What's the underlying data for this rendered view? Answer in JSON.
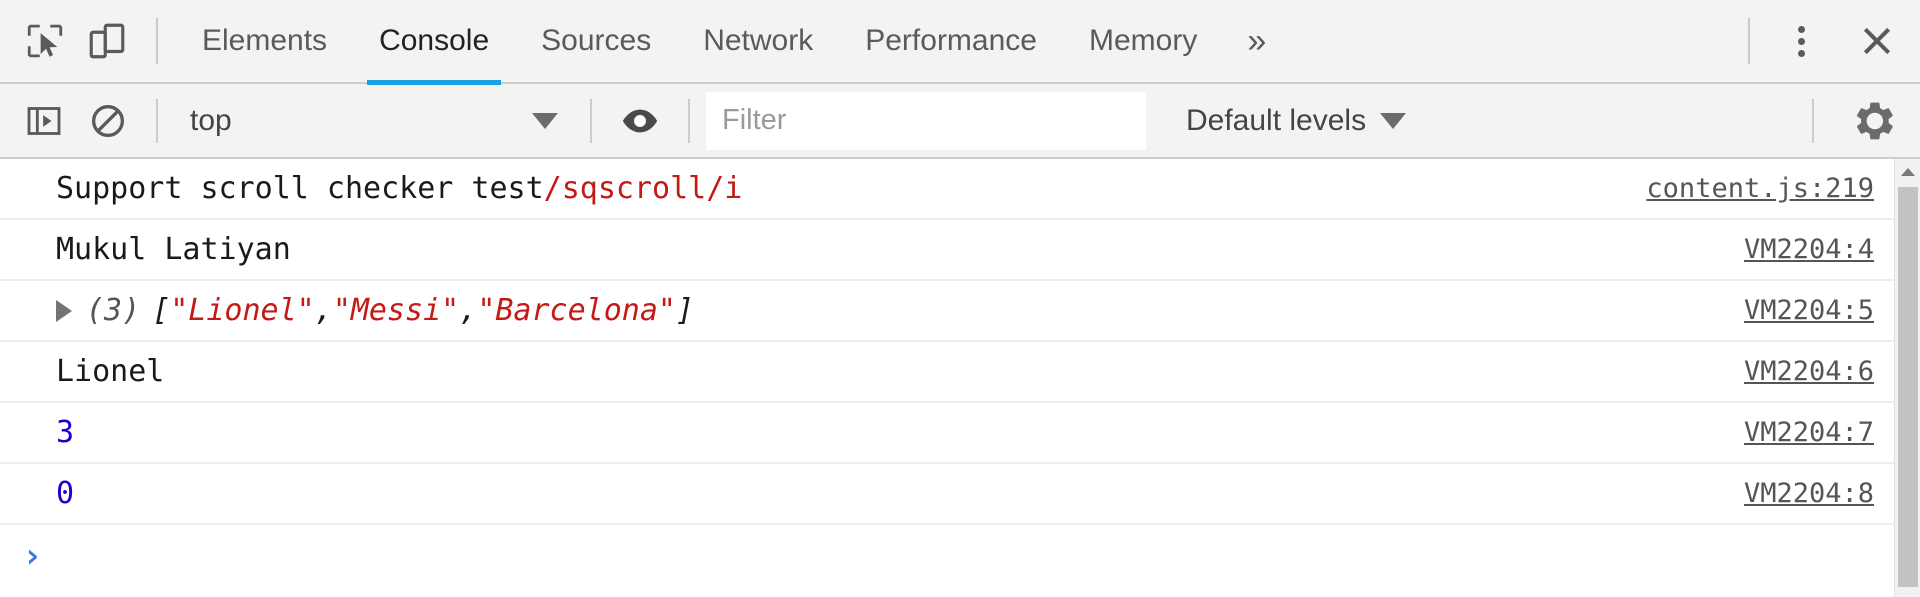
{
  "toolbar": {
    "inspect_icon": "inspect-element-icon",
    "device_icon": "device-toolbar-icon",
    "tabs": [
      {
        "label": "Elements",
        "active": false
      },
      {
        "label": "Console",
        "active": true
      },
      {
        "label": "Sources",
        "active": false
      },
      {
        "label": "Network",
        "active": false
      },
      {
        "label": "Performance",
        "active": false
      },
      {
        "label": "Memory",
        "active": false
      }
    ],
    "more_tabs_label": "»",
    "menu_icon": "kebab-menu-icon",
    "close_icon": "close-icon",
    "active_tab_accent": "#1a9fe0"
  },
  "filterbar": {
    "sidebar_toggle_icon": "console-sidebar-icon",
    "clear_icon": "clear-console-icon",
    "context_value": "top",
    "eye_icon": "live-expression-icon",
    "filter_placeholder": "Filter",
    "filter_value": "",
    "levels_label": "Default levels",
    "settings_icon": "gear-icon"
  },
  "console": {
    "messages": [
      {
        "type": "log",
        "tokens": [
          {
            "text": "Support scroll checker test ",
            "kind": "plain"
          },
          {
            "text": "/sqscroll/i",
            "kind": "string"
          }
        ],
        "source": "content.js:219",
        "expandable": false
      },
      {
        "type": "log",
        "tokens": [
          {
            "text": "Mukul Latiyan",
            "kind": "plain"
          }
        ],
        "source": "VM2204:4",
        "expandable": false
      },
      {
        "type": "array",
        "expandable": true,
        "count": "(3)",
        "tokens": [
          {
            "text": "[",
            "kind": "plain"
          },
          {
            "text": "\"Lionel\"",
            "kind": "string"
          },
          {
            "text": ", ",
            "kind": "plain"
          },
          {
            "text": "\"Messi\"",
            "kind": "string"
          },
          {
            "text": ", ",
            "kind": "plain"
          },
          {
            "text": "\"Barcelona\"",
            "kind": "string"
          },
          {
            "text": "]",
            "kind": "plain"
          }
        ],
        "source": "VM2204:5"
      },
      {
        "type": "log",
        "tokens": [
          {
            "text": "Lionel",
            "kind": "plain"
          }
        ],
        "source": "VM2204:6",
        "expandable": false
      },
      {
        "type": "log",
        "tokens": [
          {
            "text": "3",
            "kind": "number"
          }
        ],
        "source": "VM2204:7",
        "expandable": false
      },
      {
        "type": "log",
        "tokens": [
          {
            "text": "0",
            "kind": "number"
          }
        ],
        "source": "VM2204:8",
        "expandable": false
      }
    ],
    "prompt_chevron": "›",
    "prompt_value": "",
    "colors": {
      "string": "#c41a16",
      "number": "#1c00cf",
      "plain": "#1a1a1a",
      "source_link": "#555555",
      "prompt": "#3b78e7"
    }
  }
}
